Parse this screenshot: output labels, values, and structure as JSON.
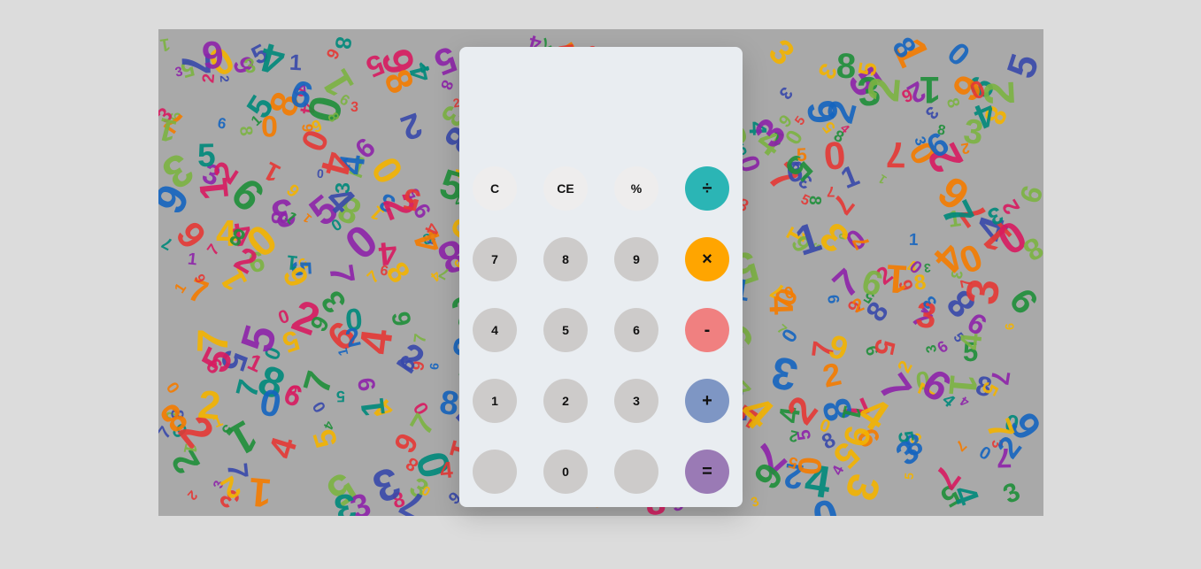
{
  "display": {
    "value": ""
  },
  "background_digits": {
    "glyphs": [
      "0",
      "1",
      "2",
      "3",
      "4",
      "5",
      "6",
      "7",
      "8",
      "9"
    ],
    "palette": [
      "#1f8f3a",
      "#d81b60",
      "#f4b400",
      "#1565c0",
      "#8e24aa",
      "#e53935",
      "#00897b",
      "#7cb342",
      "#f57c00",
      "#3949ab"
    ]
  },
  "keys": [
    {
      "id": "clear-button",
      "label": "C",
      "kind": "func",
      "color": "#eeeded"
    },
    {
      "id": "clear-entry-button",
      "label": "CE",
      "kind": "func",
      "color": "#eeeded"
    },
    {
      "id": "percent-button",
      "label": "%",
      "kind": "func",
      "color": "#eeeded"
    },
    {
      "id": "divide-button",
      "label": "÷",
      "kind": "op",
      "color": "#2bb5b5"
    },
    {
      "id": "digit-7-button",
      "label": "7",
      "kind": "num",
      "color": "#cdcbca"
    },
    {
      "id": "digit-8-button",
      "label": "8",
      "kind": "num",
      "color": "#cdcbca"
    },
    {
      "id": "digit-9-button",
      "label": "9",
      "kind": "num",
      "color": "#cdcbca"
    },
    {
      "id": "multiply-button",
      "label": "×",
      "kind": "op",
      "color": "#ffa500"
    },
    {
      "id": "digit-4-button",
      "label": "4",
      "kind": "num",
      "color": "#cdcbca"
    },
    {
      "id": "digit-5-button",
      "label": "5",
      "kind": "num",
      "color": "#cdcbca"
    },
    {
      "id": "digit-6-button",
      "label": "6",
      "kind": "num",
      "color": "#cdcbca"
    },
    {
      "id": "subtract-button",
      "label": "-",
      "kind": "op",
      "color": "#f08080"
    },
    {
      "id": "digit-1-button",
      "label": "1",
      "kind": "num",
      "color": "#cdcbca"
    },
    {
      "id": "digit-2-button",
      "label": "2",
      "kind": "num",
      "color": "#cdcbca"
    },
    {
      "id": "digit-3-button",
      "label": "3",
      "kind": "num",
      "color": "#cdcbca"
    },
    {
      "id": "add-button",
      "label": "+",
      "kind": "op",
      "color": "#7e96c4"
    },
    {
      "id": "blank-left-button",
      "label": "",
      "kind": "num",
      "color": "#cdcbca"
    },
    {
      "id": "digit-0-button",
      "label": "0",
      "kind": "num",
      "color": "#cdcbca"
    },
    {
      "id": "blank-right-button",
      "label": "",
      "kind": "num",
      "color": "#cdcbca"
    },
    {
      "id": "equals-button",
      "label": "=",
      "kind": "op",
      "color": "#9a7ab5"
    }
  ]
}
